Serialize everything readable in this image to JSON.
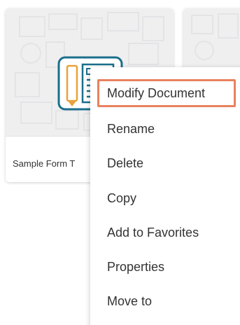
{
  "cards": [
    {
      "title": "Sample Form T",
      "icon": "form-document-icon",
      "thumbnail": "pattern-background"
    },
    {
      "title": "",
      "icon": "form-document-icon",
      "thumbnail": "pattern-background"
    }
  ],
  "context_menu": {
    "items": [
      {
        "label": "Modify Document",
        "highlighted": true
      },
      {
        "label": "Rename"
      },
      {
        "label": "Delete"
      },
      {
        "label": "Copy"
      },
      {
        "label": "Add to Favorites"
      },
      {
        "label": "Properties"
      },
      {
        "label": "Move to"
      }
    ]
  },
  "colors": {
    "highlight_border": "#e8815e",
    "icon_teal": "#1b6f8c",
    "icon_pencil": "#e9a23b",
    "thumbnail_bg": "#efeff0"
  }
}
